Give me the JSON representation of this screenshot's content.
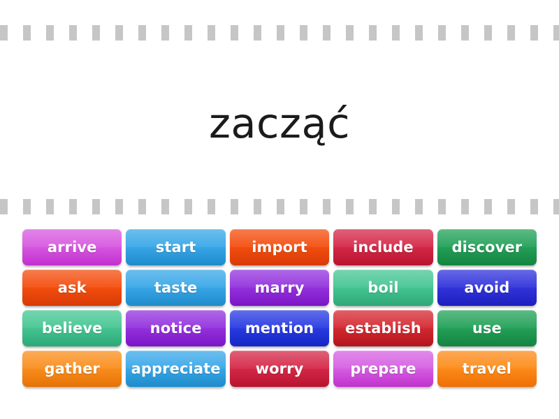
{
  "activity": {
    "type": "match-up-word-game",
    "prompt_word": "zacząć",
    "separator_style": "dashed-gray"
  },
  "colors": {
    "page_background": "#ffffff",
    "prompt_text": "#1b1b1b",
    "dash_gray": "#c6c6c6",
    "tile_text": "#ffffff",
    "orchid": "#cc44cc",
    "orchid_dark": "#b52ecb",
    "sky_blue": "#2f9fe0",
    "sky_blue_dark": "#1b8ecd",
    "orange_red": "#ee4307",
    "orange_red_dark": "#d93a05",
    "crimson": "#cf1f3e",
    "crimson_dark": "#b5122f",
    "green": "#1f9b4e",
    "green_dark": "#15833f",
    "purple": "#8b24d6",
    "purple_dark": "#7a13c6",
    "mint": "#3cbb8a",
    "mint_dark": "#2da877",
    "indigo": "#2a2ed0",
    "indigo_dark": "#1d20bd",
    "blue": "#1f33d8",
    "blue_dark": "#1526c4",
    "red": "#cc2128",
    "red_dark": "#b2151c",
    "orange": "#f58410",
    "orange_dark": "#e07205",
    "magenta": "#cb50d8",
    "magenta_dark": "#bb2fcb",
    "travel_orange": "#f98012",
    "travel_orange_dark": "#ec6f05"
  },
  "tiles": {
    "rows": [
      [
        {
          "label": "arrive",
          "color_start": "#d75ae0",
          "color_end": "#c22fd0"
        },
        {
          "label": "start",
          "color_start": "#3aa8e8",
          "color_end": "#1e8ccb"
        },
        {
          "label": "import",
          "color_start": "#f44f10",
          "color_end": "#d93a05"
        },
        {
          "label": "include",
          "color_start": "#d52a49",
          "color_end": "#b9132f"
        },
        {
          "label": "discover",
          "color_start": "#24a25a",
          "color_end": "#148440"
        }
      ],
      [
        {
          "label": "ask",
          "color_start": "#f44f10",
          "color_end": "#d93a05"
        },
        {
          "label": "taste",
          "color_start": "#3aa8e8",
          "color_end": "#1e8ccb"
        },
        {
          "label": "marry",
          "color_start": "#9434de",
          "color_end": "#7c14c6"
        },
        {
          "label": "boil",
          "color_start": "#47c694",
          "color_end": "#2da877"
        },
        {
          "label": "avoid",
          "color_start": "#3335dc",
          "color_end": "#1d20bd"
        }
      ],
      [
        {
          "label": "believe",
          "color_start": "#47c694",
          "color_end": "#2da877"
        },
        {
          "label": "notice",
          "color_start": "#9434de",
          "color_end": "#7c14c6"
        },
        {
          "label": "mention",
          "color_start": "#2a3ce2",
          "color_end": "#1526c4"
        },
        {
          "label": "establish",
          "color_start": "#d52a32",
          "color_end": "#b2151c"
        },
        {
          "label": "use",
          "color_start": "#24a25a",
          "color_end": "#148440"
        }
      ],
      [
        {
          "label": "gather",
          "color_start": "#fa8f1e",
          "color_end": "#e57205"
        },
        {
          "label": "appreciate",
          "color_start": "#3aa8e8",
          "color_end": "#1e8ccb"
        },
        {
          "label": "worry",
          "color_start": "#d52a49",
          "color_end": "#b9132f"
        },
        {
          "label": "prepare",
          "color_start": "#d661e2",
          "color_end": "#c132cd"
        },
        {
          "label": "travel",
          "color_start": "#fd8c1b",
          "color_end": "#ee6f05"
        }
      ]
    ]
  }
}
